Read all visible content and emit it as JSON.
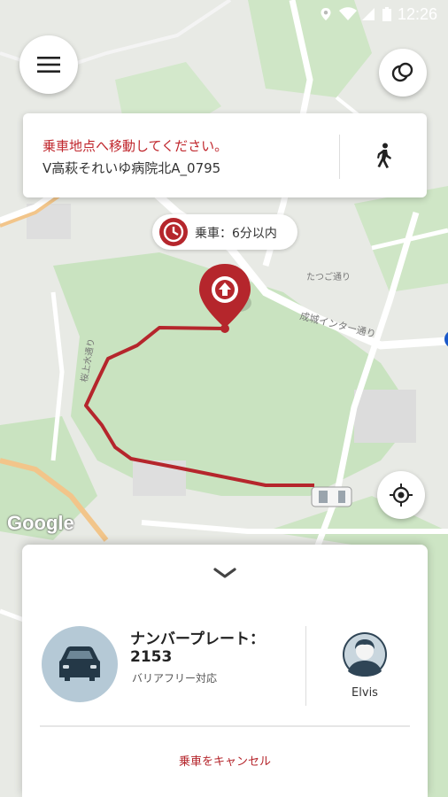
{
  "status_bar": {
    "time": "12:26"
  },
  "map": {
    "road_labels": [
      "成城インター通り",
      "たつご通り",
      "桜上水通り"
    ],
    "attribution": "Google"
  },
  "directions_card": {
    "instruction": "乗車地点へ移動してください。",
    "pickup_location": "V高萩それいゆ病院北A_0795"
  },
  "eta": {
    "label": "乗車：6分以内"
  },
  "bottom_sheet": {
    "plate_label": "ナンバープレート：",
    "plate_number": "2153",
    "vehicle_feature": "バリアフリー対応",
    "driver_name": "Elvis",
    "cancel_label": "乗車をキャンセル"
  },
  "colors": {
    "accent": "#b5262c",
    "route": "#b5262c"
  },
  "icons": [
    "menu-icon",
    "layers-icon",
    "walk-icon",
    "clock-icon",
    "pickup-pin-icon",
    "locate-icon",
    "chevron-down-icon",
    "car-icon",
    "driver-avatar-icon",
    "car-top-icon"
  ]
}
